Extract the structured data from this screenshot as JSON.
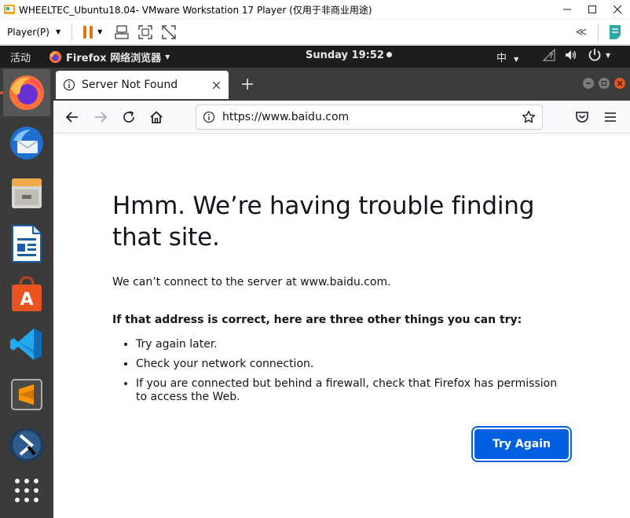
{
  "vmware": {
    "window_title": "WHEELTEC_Ubuntu18.04- VMware Workstation 17 Player (仅用于非商业用途)",
    "player_menu": "Player(P)",
    "colors": {
      "pause": "#e8720c",
      "accent": "#2fa7a2"
    }
  },
  "gnome": {
    "activities": "活动",
    "app_menu": "Firefox 网络浏览器",
    "clock": "Sunday 19:52",
    "input_method": "中"
  },
  "dock": {
    "apps": [
      "firefox-icon",
      "thunderbird-icon",
      "files-icon",
      "libreoffice-writer-icon",
      "ubuntu-software-icon",
      "vscode-icon",
      "sublime-text-icon",
      "kodi-icon",
      "show-apps-icon"
    ]
  },
  "firefox": {
    "tab_title": "Server Not Found",
    "url": "https://www.baidu.com"
  },
  "error_page": {
    "title": "Hmm. We’re having trouble finding that site.",
    "description": "We can’t connect to the server at www.baidu.com.",
    "subtitle": "If that address is correct, here are three other things you can try:",
    "suggestions": [
      "Try again later.",
      "Check your network connection.",
      "If you are connected but behind a firewall, check that Firefox has permission to access the Web."
    ],
    "button_label": "Try Again"
  }
}
